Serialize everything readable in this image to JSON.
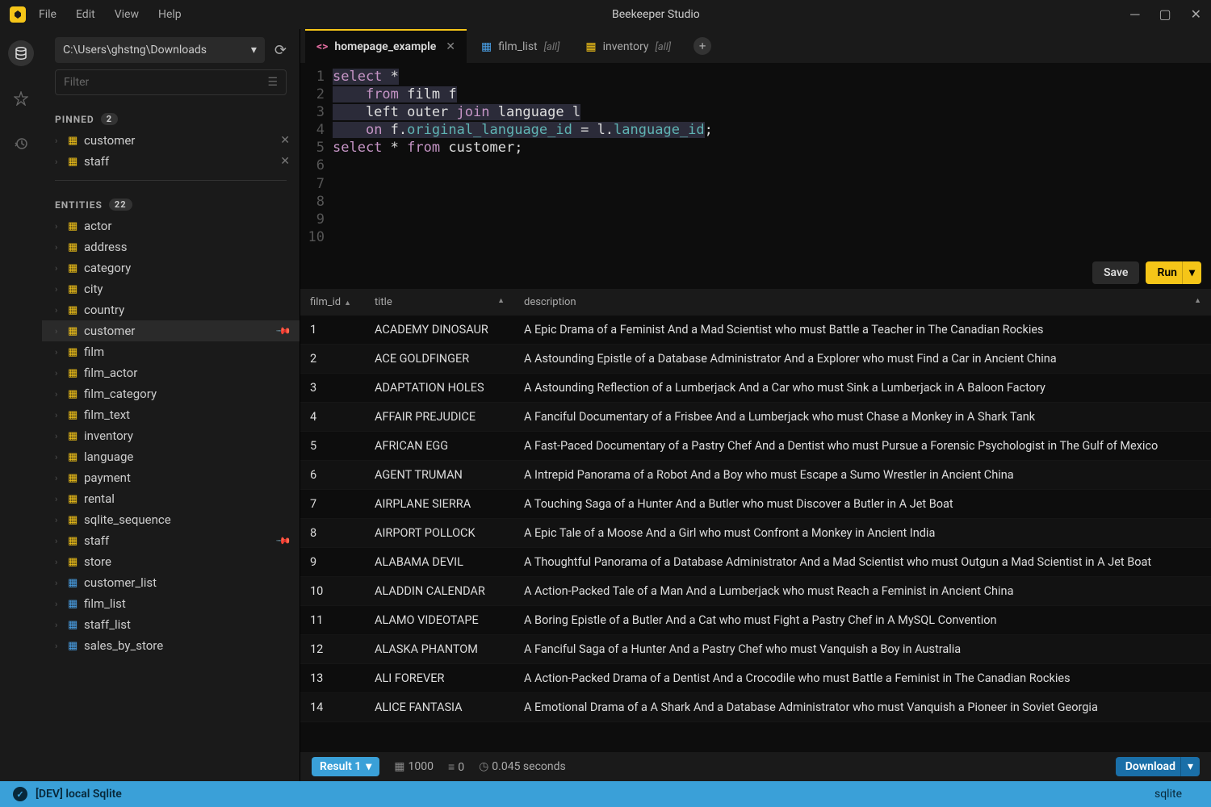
{
  "app": {
    "title": "Beekeeper Studio"
  },
  "menu": [
    "File",
    "Edit",
    "View",
    "Help"
  ],
  "connection": {
    "path": "C:\\Users\\ghstng\\Downloads",
    "filter_placeholder": "Filter"
  },
  "pinned": {
    "label": "PINNED",
    "count": "2",
    "items": [
      {
        "name": "customer"
      },
      {
        "name": "staff"
      }
    ]
  },
  "entities": {
    "label": "ENTITIES",
    "count": "22",
    "items": [
      {
        "name": "actor",
        "type": "table"
      },
      {
        "name": "address",
        "type": "table"
      },
      {
        "name": "category",
        "type": "table"
      },
      {
        "name": "city",
        "type": "table"
      },
      {
        "name": "country",
        "type": "table"
      },
      {
        "name": "customer",
        "type": "table",
        "pinned": true,
        "active": true
      },
      {
        "name": "film",
        "type": "table"
      },
      {
        "name": "film_actor",
        "type": "table"
      },
      {
        "name": "film_category",
        "type": "table"
      },
      {
        "name": "film_text",
        "type": "table"
      },
      {
        "name": "inventory",
        "type": "table"
      },
      {
        "name": "language",
        "type": "table"
      },
      {
        "name": "payment",
        "type": "table"
      },
      {
        "name": "rental",
        "type": "table"
      },
      {
        "name": "sqlite_sequence",
        "type": "table"
      },
      {
        "name": "staff",
        "type": "table",
        "pinned": true
      },
      {
        "name": "store",
        "type": "table"
      },
      {
        "name": "customer_list",
        "type": "view"
      },
      {
        "name": "film_list",
        "type": "view"
      },
      {
        "name": "staff_list",
        "type": "view"
      },
      {
        "name": "sales_by_store",
        "type": "view"
      }
    ]
  },
  "tabs": [
    {
      "icon": "code",
      "name": "homepage_example",
      "extra": "",
      "active": true,
      "closable": true
    },
    {
      "icon": "table",
      "name": "film_list",
      "extra": "[all]"
    },
    {
      "icon": "table-y",
      "name": "inventory",
      "extra": "[all]"
    }
  ],
  "editor": {
    "lines": [
      {
        "n": 1,
        "seg": [
          {
            "t": "select",
            "c": "kw sel"
          },
          {
            "t": " ",
            "c": "sel"
          },
          {
            "t": "*",
            "c": "str sel"
          }
        ]
      },
      {
        "n": 2,
        "seg": [
          {
            "t": "    ",
            "c": "sel"
          },
          {
            "t": "from",
            "c": "kw sel"
          },
          {
            "t": " film f",
            "c": "str sel"
          }
        ]
      },
      {
        "n": 3,
        "seg": [
          {
            "t": "    left outer ",
            "c": "str sel"
          },
          {
            "t": "join",
            "c": "kw sel"
          },
          {
            "t": " language l",
            "c": "str sel"
          }
        ]
      },
      {
        "n": 4,
        "seg": [
          {
            "t": "    ",
            "c": "sel"
          },
          {
            "t": "on",
            "c": "kw sel"
          },
          {
            "t": " f.",
            "c": "str sel"
          },
          {
            "t": "original_language_id",
            "c": "ident2 sel"
          },
          {
            "t": " = l.",
            "c": "str sel"
          },
          {
            "t": "language_id",
            "c": "ident2 sel"
          },
          {
            "t": ";",
            "c": "str"
          }
        ]
      },
      {
        "n": 5,
        "seg": [
          {
            "t": "select",
            "c": "kw"
          },
          {
            "t": " * ",
            "c": "str"
          },
          {
            "t": "from",
            "c": "kw"
          },
          {
            "t": " customer;",
            "c": "str"
          }
        ]
      },
      {
        "n": 6,
        "seg": []
      },
      {
        "n": 7,
        "seg": []
      },
      {
        "n": 8,
        "seg": []
      },
      {
        "n": 9,
        "seg": []
      },
      {
        "n": 10,
        "seg": []
      }
    ]
  },
  "actions": {
    "save": "Save",
    "run": "Run"
  },
  "results": {
    "columns": [
      "film_id",
      "title",
      "description"
    ],
    "rows": [
      {
        "id": "1",
        "title": "ACADEMY DINOSAUR",
        "desc": "A Epic Drama of a Feminist And a Mad Scientist who must Battle a Teacher in The Canadian Rockies"
      },
      {
        "id": "2",
        "title": "ACE GOLDFINGER",
        "desc": "A Astounding Epistle of a Database Administrator And a Explorer who must Find a Car in Ancient China"
      },
      {
        "id": "3",
        "title": "ADAPTATION HOLES",
        "desc": "A Astounding Reflection of a Lumberjack And a Car who must Sink a Lumberjack in A Baloon Factory"
      },
      {
        "id": "4",
        "title": "AFFAIR PREJUDICE",
        "desc": "A Fanciful Documentary of a Frisbee And a Lumberjack who must Chase a Monkey in A Shark Tank"
      },
      {
        "id": "5",
        "title": "AFRICAN EGG",
        "desc": "A Fast-Paced Documentary of a Pastry Chef And a Dentist who must Pursue a Forensic Psychologist in The Gulf of Mexico"
      },
      {
        "id": "6",
        "title": "AGENT TRUMAN",
        "desc": "A Intrepid Panorama of a Robot And a Boy who must Escape a Sumo Wrestler in Ancient China"
      },
      {
        "id": "7",
        "title": "AIRPLANE SIERRA",
        "desc": "A Touching Saga of a Hunter And a Butler who must Discover a Butler in A Jet Boat"
      },
      {
        "id": "8",
        "title": "AIRPORT POLLOCK",
        "desc": "A Epic Tale of a Moose And a Girl who must Confront a Monkey in Ancient India"
      },
      {
        "id": "9",
        "title": "ALABAMA DEVIL",
        "desc": "A Thoughtful Panorama of a Database Administrator And a Mad Scientist who must Outgun a Mad Scientist in A Jet Boat"
      },
      {
        "id": "10",
        "title": "ALADDIN CALENDAR",
        "desc": "A Action-Packed Tale of a Man And a Lumberjack who must Reach a Feminist in Ancient China"
      },
      {
        "id": "11",
        "title": "ALAMO VIDEOTAPE",
        "desc": "A Boring Epistle of a Butler And a Cat who must Fight a Pastry Chef in A MySQL Convention"
      },
      {
        "id": "12",
        "title": "ALASKA PHANTOM",
        "desc": "A Fanciful Saga of a Hunter And a Pastry Chef who must Vanquish a Boy in Australia"
      },
      {
        "id": "13",
        "title": "ALI FOREVER",
        "desc": "A Action-Packed Drama of a Dentist And a Crocodile who must Battle a Feminist in The Canadian Rockies"
      },
      {
        "id": "14",
        "title": "ALICE FANTASIA",
        "desc": "A Emotional Drama of a A Shark And a Database Administrator who must Vanquish a Pioneer in Soviet Georgia"
      }
    ]
  },
  "footer": {
    "result_tab": "Result 1",
    "rowcount": "1000",
    "null_count": "0",
    "time": "0.045 seconds",
    "download": "Download"
  },
  "status": {
    "conn": "[DEV] local Sqlite",
    "type": "sqlite"
  }
}
